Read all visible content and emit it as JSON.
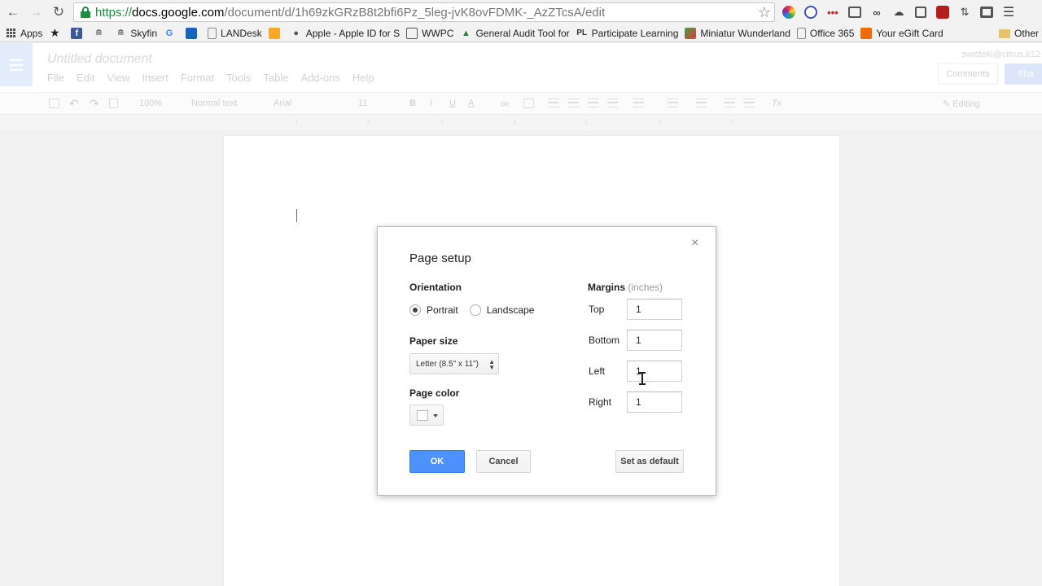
{
  "browser": {
    "url_scheme": "https://",
    "url_host": "docs.google.com",
    "url_path": "/document/d/1h69zkGRzB8t2bfi6Pz_5leg-jvK8ovFDMK-_AzZTcsA/edit",
    "bookmarks": [
      {
        "label": "Apps",
        "icon": "apps-grid-icon"
      },
      {
        "label": "",
        "icon": "star-icon"
      },
      {
        "label": "",
        "icon": "facebook-icon"
      },
      {
        "label": "",
        "icon": "signal-icon"
      },
      {
        "label": "Skyfin",
        "icon": "skyfin-icon"
      },
      {
        "label": "",
        "icon": "google-icon"
      },
      {
        "label": "",
        "icon": "bookmark-icon"
      },
      {
        "label": "LANDesk",
        "icon": "page-icon"
      },
      {
        "label": "",
        "icon": "bookmark-icon"
      },
      {
        "label": "Apple - Apple ID for S",
        "icon": "apple-icon"
      },
      {
        "label": "WWPC",
        "icon": "bookmark-icon"
      },
      {
        "label": "General Audit Tool for",
        "icon": "bookmark-icon"
      },
      {
        "label": "Participate Learning",
        "icon": "pl-icon"
      },
      {
        "label": "Miniatur Wunderland",
        "icon": "bookmark-icon"
      },
      {
        "label": "Office 365",
        "icon": "page-icon"
      },
      {
        "label": "Your eGift Card",
        "icon": "bookmark-icon"
      }
    ],
    "other_bookmarks": "Other"
  },
  "docs": {
    "title": "Untitled document",
    "user": "swisteki@citrus.k12",
    "menu": [
      "File",
      "Edit",
      "View",
      "Insert",
      "Format",
      "Tools",
      "Table",
      "Add-ons",
      "Help"
    ],
    "comments_label": "Comments",
    "share_label": "Sha",
    "zoom": "100%",
    "style": "Normal text",
    "font": "Arial",
    "font_size": "11",
    "bold": "B",
    "italic": "I",
    "underline": "U",
    "text_color": "A",
    "clear_format": "Tx",
    "mode": "Editing",
    "ruler_numbers": [
      "1",
      "2",
      "3",
      "4",
      "5",
      "6",
      "7"
    ]
  },
  "dialog": {
    "title": "Page setup",
    "close": "×",
    "orientation_label": "Orientation",
    "portrait_label": "Portrait",
    "landscape_label": "Landscape",
    "paper_size_label": "Paper size",
    "paper_size_value": "Letter (8.5\" x 11\")",
    "page_color_label": "Page color",
    "margins_label": "Margins",
    "margins_unit": "(inches)",
    "top_label": "Top",
    "top_value": "1",
    "bottom_label": "Bottom",
    "bottom_value": "1",
    "left_label": "Left",
    "left_value": "1",
    "right_label": "Right",
    "right_value": "1",
    "ok_label": "OK",
    "cancel_label": "Cancel",
    "default_label": "Set as default"
  },
  "colors": {
    "ok_button": "#4d90fe",
    "url_green": "#1e8e3e"
  }
}
